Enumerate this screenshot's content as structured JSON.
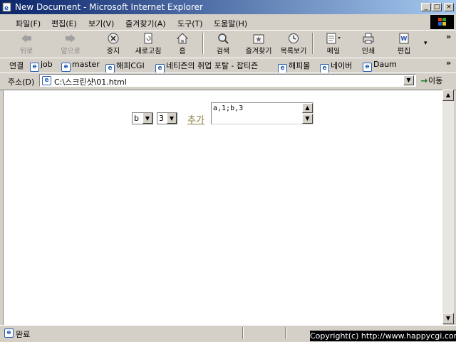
{
  "window": {
    "title": "New Document - Microsoft Internet Explorer",
    "minimize": "_",
    "maximize": "□",
    "close": "×"
  },
  "menu": {
    "items": [
      "파일(F)",
      "편집(E)",
      "보기(V)",
      "즐겨찾기(A)",
      "도구(T)",
      "도움말(H)"
    ]
  },
  "toolbar": {
    "buttons": [
      "뒤로",
      "앞으로",
      "중지",
      "새로고침",
      "홈",
      "검색",
      "즐겨찾기",
      "목록보기",
      "메일",
      "인쇄",
      "편집"
    ],
    "chevron": "»"
  },
  "links": {
    "label": "연결",
    "items": [
      "job",
      "master",
      "해피CGI",
      "네티즌의 취업 포탈 - 잡티즌",
      "해피몰",
      "네이버",
      "Daum"
    ],
    "chevron": "»"
  },
  "address": {
    "label": "주소(D)",
    "value": "C:\\스크린샷\\01.html",
    "go_label": "이동"
  },
  "page": {
    "select1_value": "b",
    "select2_value": "3",
    "add_link": "추가",
    "textarea_value": "a,1;b,3"
  },
  "status": {
    "text": "완료",
    "copyright": "Copyright(c) http://www.happycgi.com"
  },
  "colors": {
    "titlebar_start": "#0a246a",
    "titlebar_end": "#a6caf0",
    "chrome": "#d4d0c8",
    "link": "#8a7a3a"
  },
  "icons": {
    "title": "ie-page-icon",
    "address": "ie-page-icon",
    "go": "go-arrow-icon"
  }
}
